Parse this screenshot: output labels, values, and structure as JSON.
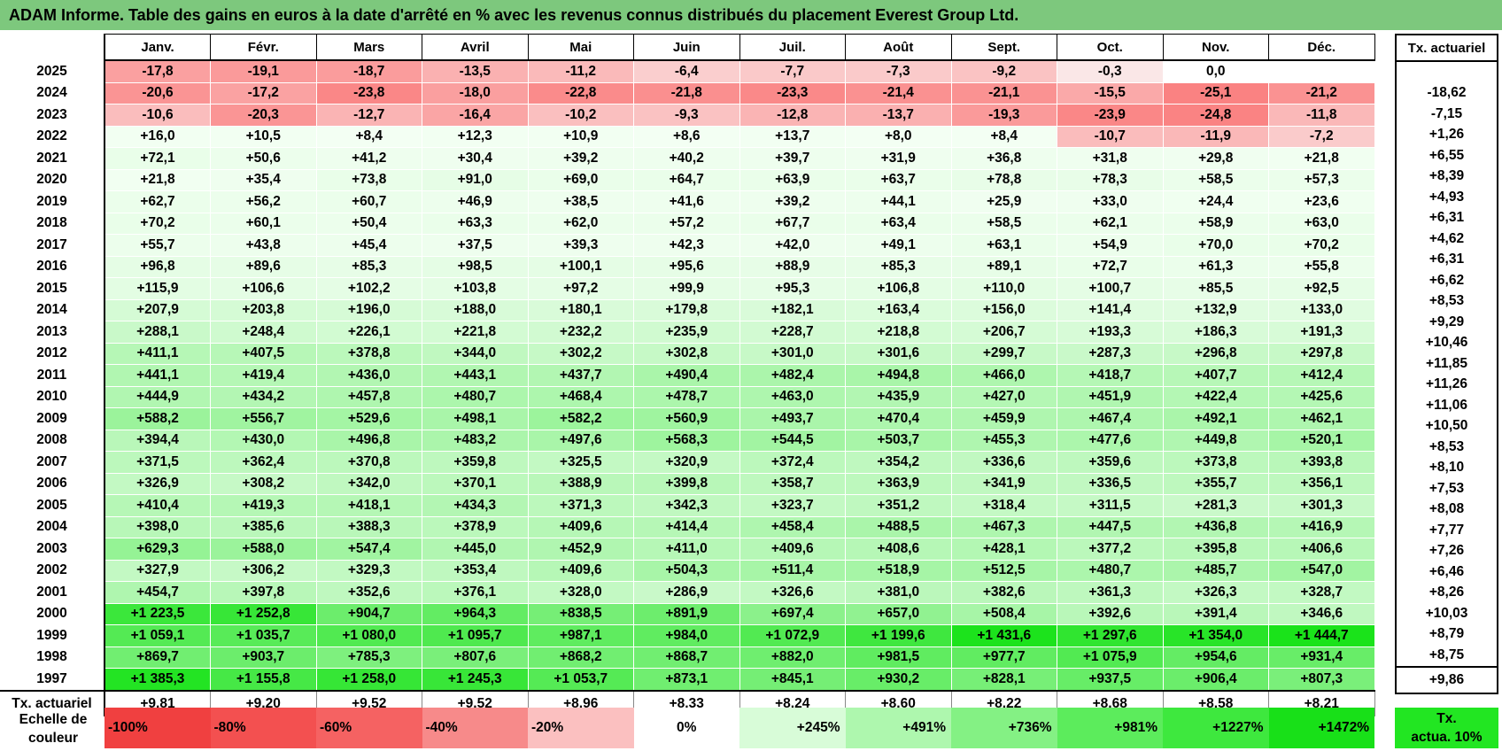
{
  "title": "ADAM Informe. Table des gains en euros à la date d'arrêté en % avec les revenus connus distribués du placement Everest Group Ltd.",
  "months": [
    "Janv.",
    "Févr.",
    "Mars",
    "Avril",
    "Mai",
    "Juin",
    "Juil.",
    "Août",
    "Sept.",
    "Oct.",
    "Nov.",
    "Déc."
  ],
  "side_header": "Tx. actuariel",
  "rows": [
    {
      "year": "2025",
      "vals": [
        "-17,8",
        "-19,1",
        "-18,7",
        "-13,5",
        "-11,2",
        "-6,4",
        "-7,7",
        "-7,3",
        "-9,2",
        "-0,3",
        "0,0",
        ""
      ],
      "tx": ""
    },
    {
      "year": "2024",
      "vals": [
        "-20,6",
        "-17,2",
        "-23,8",
        "-18,0",
        "-22,8",
        "-21,8",
        "-23,3",
        "-21,4",
        "-21,1",
        "-15,5",
        "-25,1",
        "-21,2"
      ],
      "tx": "-18,62"
    },
    {
      "year": "2023",
      "vals": [
        "-10,6",
        "-20,3",
        "-12,7",
        "-16,4",
        "-10,2",
        "-9,3",
        "-12,8",
        "-13,7",
        "-19,3",
        "-23,9",
        "-24,8",
        "-11,8"
      ],
      "tx": "-7,15"
    },
    {
      "year": "2022",
      "vals": [
        "+16,0",
        "+10,5",
        "+8,4",
        "+12,3",
        "+10,9",
        "+8,6",
        "+13,7",
        "+8,0",
        "+8,4",
        "-10,7",
        "-11,9",
        "-7,2"
      ],
      "tx": "+1,26"
    },
    {
      "year": "2021",
      "vals": [
        "+72,1",
        "+50,6",
        "+41,2",
        "+30,4",
        "+39,2",
        "+40,2",
        "+39,7",
        "+31,9",
        "+36,8",
        "+31,8",
        "+29,8",
        "+21,8"
      ],
      "tx": "+6,55"
    },
    {
      "year": "2020",
      "vals": [
        "+21,8",
        "+35,4",
        "+73,8",
        "+91,0",
        "+69,0",
        "+64,7",
        "+63,9",
        "+63,7",
        "+78,8",
        "+78,3",
        "+58,5",
        "+57,3"
      ],
      "tx": "+8,39"
    },
    {
      "year": "2019",
      "vals": [
        "+62,7",
        "+56,2",
        "+60,7",
        "+46,9",
        "+38,5",
        "+41,6",
        "+39,2",
        "+44,1",
        "+25,9",
        "+33,0",
        "+24,4",
        "+23,6"
      ],
      "tx": "+4,93"
    },
    {
      "year": "2018",
      "vals": [
        "+70,2",
        "+60,1",
        "+50,4",
        "+63,3",
        "+62,0",
        "+57,2",
        "+67,7",
        "+63,4",
        "+58,5",
        "+62,1",
        "+58,9",
        "+63,0"
      ],
      "tx": "+6,31"
    },
    {
      "year": "2017",
      "vals": [
        "+55,7",
        "+43,8",
        "+45,4",
        "+37,5",
        "+39,3",
        "+42,3",
        "+42,0",
        "+49,1",
        "+63,1",
        "+54,9",
        "+70,0",
        "+70,2"
      ],
      "tx": "+4,62"
    },
    {
      "year": "2016",
      "vals": [
        "+96,8",
        "+89,6",
        "+85,3",
        "+98,5",
        "+100,1",
        "+95,6",
        "+88,9",
        "+85,3",
        "+89,1",
        "+72,7",
        "+61,3",
        "+55,8"
      ],
      "tx": "+6,31"
    },
    {
      "year": "2015",
      "vals": [
        "+115,9",
        "+106,6",
        "+102,2",
        "+103,8",
        "+97,2",
        "+99,9",
        "+95,3",
        "+106,8",
        "+110,0",
        "+100,7",
        "+85,5",
        "+92,5"
      ],
      "tx": "+6,62"
    },
    {
      "year": "2014",
      "vals": [
        "+207,9",
        "+203,8",
        "+196,0",
        "+188,0",
        "+180,1",
        "+179,8",
        "+182,1",
        "+163,4",
        "+156,0",
        "+141,4",
        "+132,9",
        "+133,0"
      ],
      "tx": "+8,53"
    },
    {
      "year": "2013",
      "vals": [
        "+288,1",
        "+248,4",
        "+226,1",
        "+221,8",
        "+232,2",
        "+235,9",
        "+228,7",
        "+218,8",
        "+206,7",
        "+193,3",
        "+186,3",
        "+191,3"
      ],
      "tx": "+9,29"
    },
    {
      "year": "2012",
      "vals": [
        "+411,1",
        "+407,5",
        "+378,8",
        "+344,0",
        "+302,2",
        "+302,8",
        "+301,0",
        "+301,6",
        "+299,7",
        "+287,3",
        "+296,8",
        "+297,8"
      ],
      "tx": "+10,46"
    },
    {
      "year": "2011",
      "vals": [
        "+441,1",
        "+419,4",
        "+436,0",
        "+443,1",
        "+437,7",
        "+490,4",
        "+482,4",
        "+494,8",
        "+466,0",
        "+418,7",
        "+407,7",
        "+412,4"
      ],
      "tx": "+11,85"
    },
    {
      "year": "2010",
      "vals": [
        "+444,9",
        "+434,2",
        "+457,8",
        "+480,7",
        "+468,4",
        "+478,7",
        "+463,0",
        "+435,9",
        "+427,0",
        "+451,9",
        "+422,4",
        "+425,6"
      ],
      "tx": "+11,26"
    },
    {
      "year": "2009",
      "vals": [
        "+588,2",
        "+556,7",
        "+529,6",
        "+498,1",
        "+582,2",
        "+560,9",
        "+493,7",
        "+470,4",
        "+459,9",
        "+467,4",
        "+492,1",
        "+462,1"
      ],
      "tx": "+11,06"
    },
    {
      "year": "2008",
      "vals": [
        "+394,4",
        "+430,0",
        "+496,8",
        "+483,2",
        "+497,6",
        "+568,3",
        "+544,5",
        "+503,7",
        "+455,3",
        "+477,6",
        "+449,8",
        "+520,1"
      ],
      "tx": "+10,50"
    },
    {
      "year": "2007",
      "vals": [
        "+371,5",
        "+362,4",
        "+370,8",
        "+359,8",
        "+325,5",
        "+320,9",
        "+372,4",
        "+354,2",
        "+336,6",
        "+359,6",
        "+373,8",
        "+393,8"
      ],
      "tx": "+8,53"
    },
    {
      "year": "2006",
      "vals": [
        "+326,9",
        "+308,2",
        "+342,0",
        "+370,1",
        "+388,9",
        "+399,8",
        "+358,7",
        "+363,9",
        "+341,9",
        "+336,5",
        "+355,7",
        "+356,1"
      ],
      "tx": "+8,10"
    },
    {
      "year": "2005",
      "vals": [
        "+410,4",
        "+419,3",
        "+418,1",
        "+434,3",
        "+371,3",
        "+342,3",
        "+323,7",
        "+351,2",
        "+318,4",
        "+311,5",
        "+281,3",
        "+301,3"
      ],
      "tx": "+7,53"
    },
    {
      "year": "2004",
      "vals": [
        "+398,0",
        "+385,6",
        "+388,3",
        "+378,9",
        "+409,6",
        "+414,4",
        "+458,4",
        "+488,5",
        "+467,3",
        "+447,5",
        "+436,8",
        "+416,9"
      ],
      "tx": "+8,08"
    },
    {
      "year": "2003",
      "vals": [
        "+629,3",
        "+588,0",
        "+547,4",
        "+445,0",
        "+452,9",
        "+411,0",
        "+409,6",
        "+408,6",
        "+428,1",
        "+377,2",
        "+395,8",
        "+406,6"
      ],
      "tx": "+7,77"
    },
    {
      "year": "2002",
      "vals": [
        "+327,9",
        "+306,2",
        "+329,3",
        "+353,4",
        "+409,6",
        "+504,3",
        "+511,4",
        "+518,9",
        "+512,5",
        "+480,7",
        "+485,7",
        "+547,0"
      ],
      "tx": "+7,26"
    },
    {
      "year": "2001",
      "vals": [
        "+454,7",
        "+397,8",
        "+352,6",
        "+376,1",
        "+328,0",
        "+286,9",
        "+326,6",
        "+381,0",
        "+382,6",
        "+361,3",
        "+326,3",
        "+328,7"
      ],
      "tx": "+6,46"
    },
    {
      "year": "2000",
      "vals": [
        "+1 223,5",
        "+1 252,8",
        "+904,7",
        "+964,3",
        "+838,5",
        "+891,9",
        "+697,4",
        "+657,0",
        "+508,4",
        "+392,6",
        "+391,4",
        "+346,6"
      ],
      "tx": "+8,26"
    },
    {
      "year": "1999",
      "vals": [
        "+1 059,1",
        "+1 035,7",
        "+1 080,0",
        "+1 095,7",
        "+987,1",
        "+984,0",
        "+1 072,9",
        "+1 199,6",
        "+1 431,6",
        "+1 297,6",
        "+1 354,0",
        "+1 444,7"
      ],
      "tx": "+10,03"
    },
    {
      "year": "1998",
      "vals": [
        "+869,7",
        "+903,7",
        "+785,3",
        "+807,6",
        "+868,2",
        "+868,7",
        "+882,0",
        "+981,5",
        "+977,7",
        "+1 075,9",
        "+954,6",
        "+931,4"
      ],
      "tx": "+8,79"
    },
    {
      "year": "1997",
      "vals": [
        "+1 385,3",
        "+1 155,8",
        "+1 258,0",
        "+1 245,3",
        "+1 053,7",
        "+873,1",
        "+845,1",
        "+930,2",
        "+828,1",
        "+937,5",
        "+906,4",
        "+807,3"
      ],
      "tx": "+8,75"
    }
  ],
  "total_row": {
    "label": "Tx. actuariel",
    "vals": [
      "+9,81",
      "+9,20",
      "+9,52",
      "+9,52",
      "+8,96",
      "+8,33",
      "+8,24",
      "+8,60",
      "+8,22",
      "+8,68",
      "+8,58",
      "+8,21"
    ],
    "tx": "+9,86"
  },
  "scale": {
    "label_line1": "Echelle de",
    "label_line2": "couleur",
    "cells": [
      {
        "label": "-100%",
        "color": "#f04040",
        "kind": "neg"
      },
      {
        "label": "-80%",
        "color": "#f35050",
        "kind": "neg"
      },
      {
        "label": "-60%",
        "color": "#f56262",
        "kind": "neg"
      },
      {
        "label": "-40%",
        "color": "#f78a8a",
        "kind": "neg"
      },
      {
        "label": "-20%",
        "color": "#fbc0c0",
        "kind": "neg"
      },
      {
        "label": "0%",
        "color": "#ffffff",
        "kind": "zero"
      },
      {
        "label": "+245%",
        "color": "#d8fcd8",
        "kind": "pos"
      },
      {
        "label": "+491%",
        "color": "#aef7ae",
        "kind": "pos"
      },
      {
        "label": "+736%",
        "color": "#84f184",
        "kind": "pos"
      },
      {
        "label": "+981%",
        "color": "#5cec5c",
        "kind": "pos"
      },
      {
        "label": "+1227%",
        "color": "#3ee83e",
        "kind": "pos"
      },
      {
        "label": "+1472%",
        "color": "#18e018",
        "kind": "pos"
      }
    ],
    "tx_line1": "Tx.",
    "tx_line2": "actua. 10%",
    "tx_color": "#22e622"
  }
}
